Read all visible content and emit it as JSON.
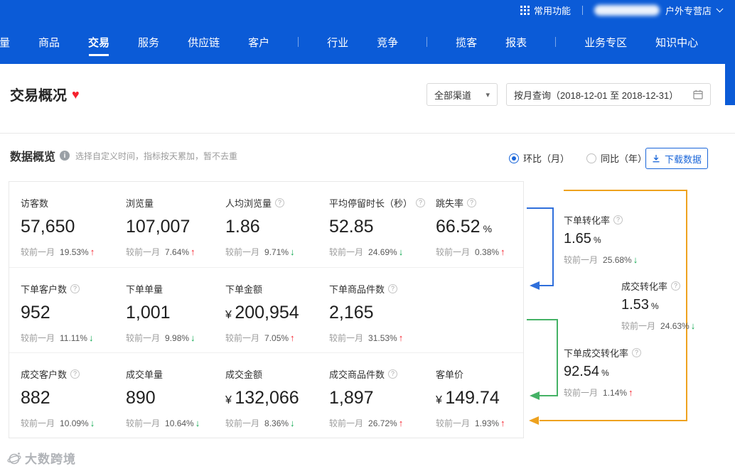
{
  "topbar": {
    "common_functions": "常用功能",
    "store_name_suffix": "户外专营店"
  },
  "nav": {
    "items": [
      "流量",
      "商品",
      "交易",
      "服务",
      "供应链",
      "客户",
      "行业",
      "竞争",
      "揽客",
      "报表",
      "业务专区",
      "知识中心"
    ],
    "active_item": "交易"
  },
  "page": {
    "title": "交易概况",
    "favorite_icon": "♥",
    "channel_filter": "全部渠道",
    "caret_icon": "▾",
    "date_query": "按月查询（2018-12-01 至 2018-12-31）"
  },
  "overview": {
    "title": "数据概览",
    "hint": "选择自定义时间，指标按天累加，暂不去重",
    "radio_mom": "环比（月）",
    "radio_yoy": "同比（年）",
    "selected_radio": "环比（月）",
    "download_button": "下载数据"
  },
  "labels": {
    "compare_prefix": "较前一月"
  },
  "icons": {
    "help": "?",
    "info": "i"
  },
  "colors": {
    "header_blue": "#0b5bd7",
    "accent_blue": "#1a66d9",
    "rise_red": "#f5222d",
    "fall_green": "#0aa64c",
    "bracket_blue": "#2f6fdb",
    "bracket_green": "#45b266",
    "bracket_orange": "#eea21f"
  },
  "metrics": {
    "row1": [
      {
        "label": "访客数",
        "value": "57,650",
        "change": "19.53%",
        "arrow": "↑",
        "dir": "up"
      },
      {
        "label": "浏览量",
        "value": "107,007",
        "change": "7.64%",
        "arrow": "↑",
        "dir": "up"
      },
      {
        "label": "人均浏览量",
        "value": "1.86",
        "change": "9.71%",
        "arrow": "↓",
        "dir": "down"
      },
      {
        "label": "平均停留时长（秒）",
        "value": "52.85",
        "change": "24.69%",
        "arrow": "↓",
        "dir": "down"
      },
      {
        "label": "跳失率",
        "value": "66.52",
        "suffix": "%",
        "change": "0.38%",
        "arrow": "↑",
        "dir": "up"
      }
    ],
    "row2": [
      {
        "label": "下单客户数",
        "value": "952",
        "change": "11.11%",
        "arrow": "↓",
        "dir": "down"
      },
      {
        "label": "下单单量",
        "value": "1,001",
        "change": "9.98%",
        "arrow": "↓",
        "dir": "down"
      },
      {
        "label": "下单金额",
        "prefix": "¥ ",
        "value": "200,954",
        "change": "7.05%",
        "arrow": "↑",
        "dir": "up"
      },
      {
        "label": "下单商品件数",
        "value": "2,165",
        "change": "31.53%",
        "arrow": "↑",
        "dir": "up"
      }
    ],
    "row3": [
      {
        "label": "成交客户数",
        "value": "882",
        "change": "10.09%",
        "arrow": "↓",
        "dir": "down"
      },
      {
        "label": "成交单量",
        "value": "890",
        "change": "10.64%",
        "arrow": "↓",
        "dir": "down"
      },
      {
        "label": "成交金额",
        "prefix": "¥ ",
        "value": "132,066",
        "change": "8.36%",
        "arrow": "↓",
        "dir": "down"
      },
      {
        "label": "成交商品件数",
        "value": "1,897",
        "change": "26.72%",
        "arrow": "↑",
        "dir": "up"
      },
      {
        "label": "客单价",
        "prefix": "¥ ",
        "value": "149.74",
        "change": "1.93%",
        "arrow": "↑",
        "dir": "up"
      }
    ]
  },
  "conversions": [
    {
      "label": "下单转化率",
      "value": "1.65",
      "suffix": "%",
      "change": "25.68%",
      "arrow": "↓",
      "dir": "down"
    },
    {
      "label": "成交转化率",
      "value": "1.53",
      "suffix": "%",
      "change": "24.63%",
      "arrow": "↓",
      "dir": "down"
    },
    {
      "label": "下单成交转化率",
      "value": "92.54",
      "suffix": "%",
      "change": "1.14%",
      "arrow": "↑",
      "dir": "up"
    }
  ],
  "watermark": {
    "text": "大数跨境"
  }
}
